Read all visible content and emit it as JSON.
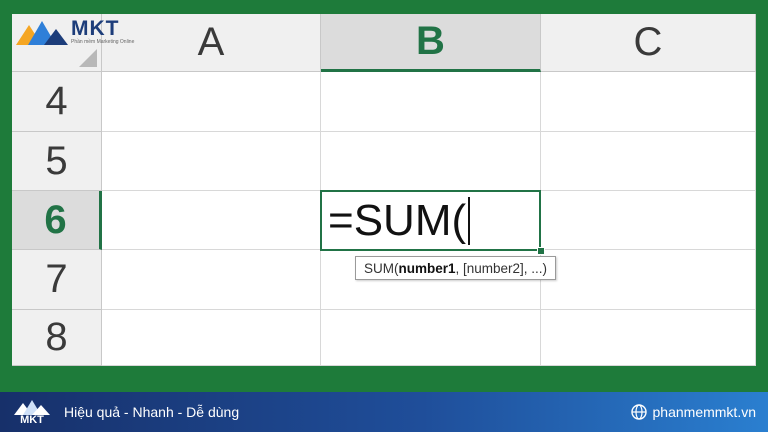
{
  "brand": {
    "logo_text": "MKT",
    "logo_subtext": "Phần mềm Marketing Online"
  },
  "columns": [
    {
      "label": "A",
      "active": false
    },
    {
      "label": "B",
      "active": true
    },
    {
      "label": "C",
      "active": false
    }
  ],
  "rows": [
    {
      "label": "4",
      "active": false
    },
    {
      "label": "5",
      "active": false
    },
    {
      "label": "6",
      "active": true
    },
    {
      "label": "7",
      "active": false
    },
    {
      "label": "8",
      "active": false
    }
  ],
  "active_cell": {
    "reference": "B6",
    "formula": "=SUM("
  },
  "tooltip": {
    "function": "SUM(",
    "arg1": "number1",
    "rest": ", [number2], ...)"
  },
  "footer": {
    "logo_text": "MKT",
    "slogan": "Hiệu quả - Nhanh  - Dễ dùng",
    "website": "phanmemmkt.vn"
  },
  "colors": {
    "frame": "#1e7b3a",
    "excel_green": "#217346",
    "footer_start": "#17306a",
    "footer_end": "#2a7fd0"
  }
}
